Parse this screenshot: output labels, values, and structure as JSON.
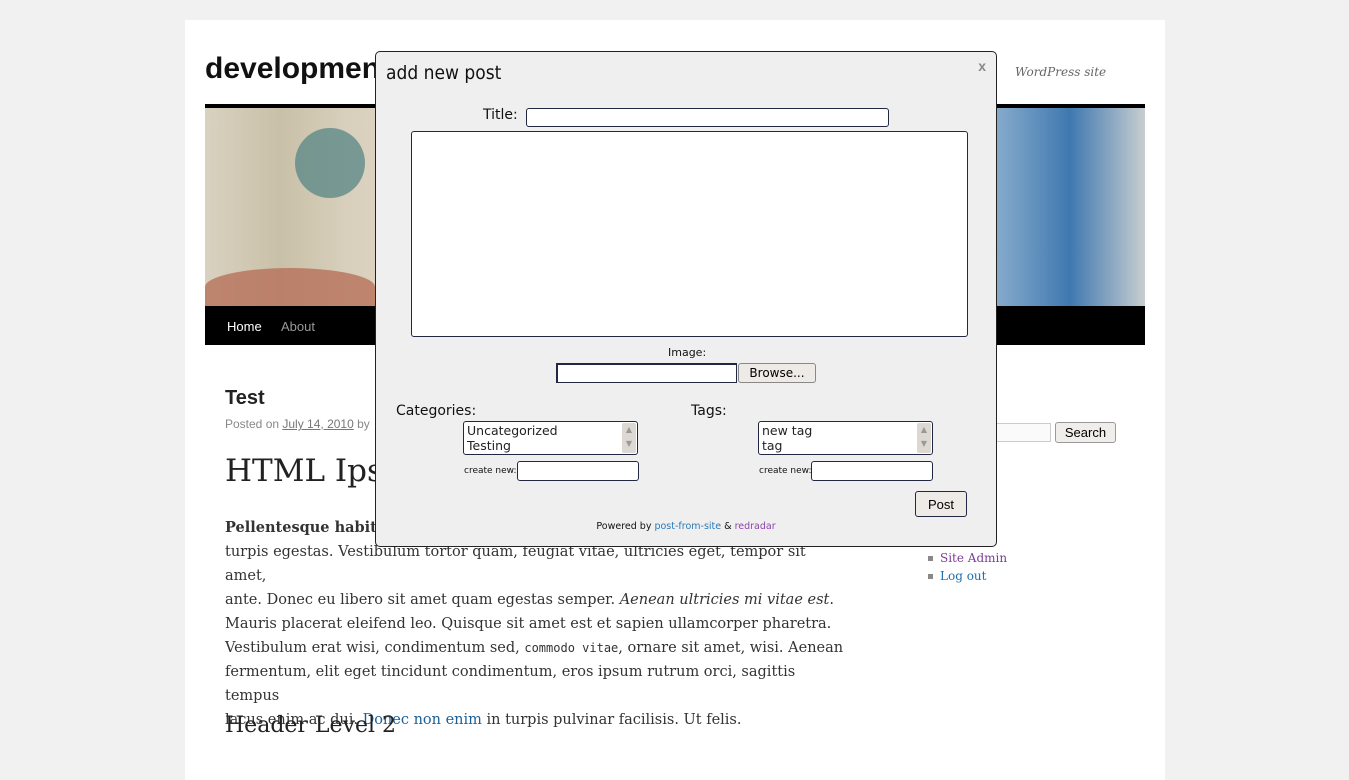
{
  "site": {
    "title": "developmen",
    "description": "WordPress site"
  },
  "nav": {
    "items": [
      {
        "label": "Home",
        "color": "#ffffff"
      },
      {
        "label": "About",
        "color": "#999999"
      }
    ]
  },
  "post": {
    "title": "Test",
    "meta_prefix": "Posted on ",
    "meta_date": "July 14, 2010",
    "meta_by": " by",
    "heading1": "HTML Ipsu",
    "para_bold": "Pellentesque habit",
    "line2": "turpis egestas. Vestibulum tortor quam, feugiat vitae, ultricies eget, tempor sit amet,",
    "line3a": "ante. Donec eu libero sit amet quam egestas semper. ",
    "line3b": "Aenean ultricies mi vitae est",
    "line3c": ".",
    "line4": "Mauris placerat eleifend leo. Quisque sit amet est et sapien ullamcorper pharetra.",
    "line5a": "Vestibulum erat wisi, condimentum sed, ",
    "line5code": "commodo vitae",
    "line5b": ", ornare sit amet, wisi. Aenean",
    "line6": "fermentum, elit eget tincidunt condimentum, eros ipsum rutrum orci, sagittis tempus",
    "line7a": "lacus enim ac dui. ",
    "line7link": "Donec non enim",
    "line7b": " in turpis pulvinar facilisis. Ut felis.",
    "heading2": "Header Level 2"
  },
  "sidebar": {
    "search_label": "Search",
    "meta_links": [
      {
        "label": "Site Admin",
        "color": "#7d3c98"
      },
      {
        "label": "Log out",
        "color": "#1b6fb0"
      }
    ]
  },
  "modal": {
    "title": "add new post",
    "close": "x",
    "title_label": "Title:",
    "title_value": "",
    "body_value": "",
    "image_label": "Image:",
    "browse_label": "Browse...",
    "categories_label": "Categories:",
    "categories": [
      "Uncategorized",
      "Testing"
    ],
    "tags_label": "Tags:",
    "tags": [
      "new tag",
      "tag"
    ],
    "create_new_label": "create new:",
    "post_label": "Post",
    "powered_by": "Powered by ",
    "link1": "post-from-site",
    "amp": " & ",
    "link2": "redradar",
    "link1_color": "#2a7ab8",
    "link2_color": "#8e44ad"
  }
}
